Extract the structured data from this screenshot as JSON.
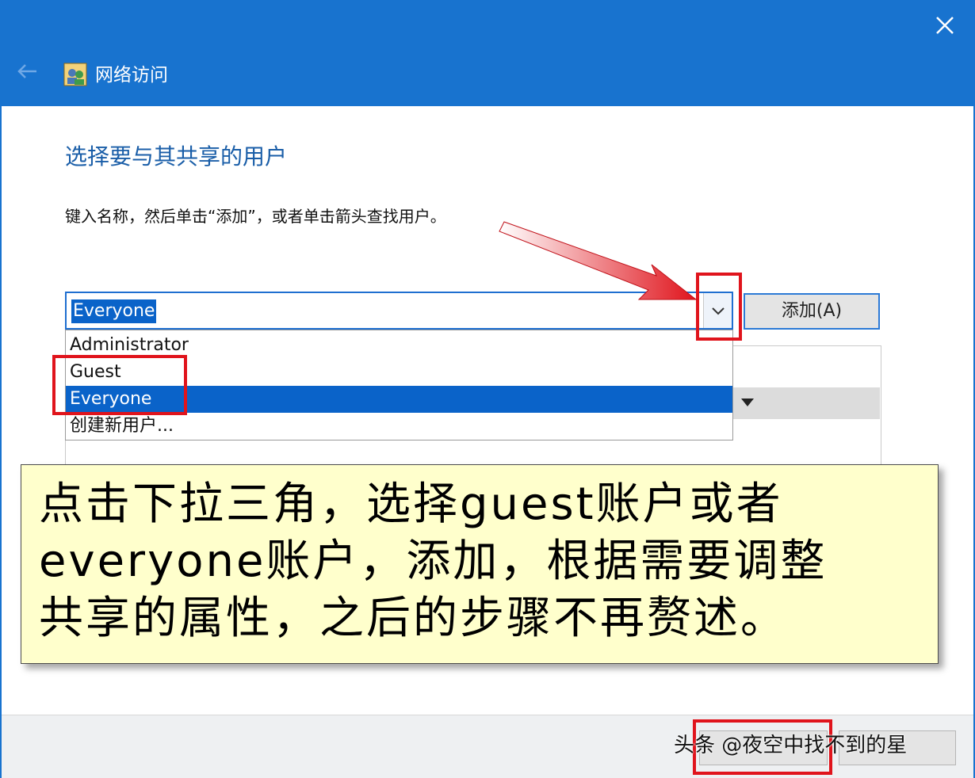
{
  "window": {
    "title": "网络访问"
  },
  "page": {
    "heading": "选择要与其共享的用户",
    "instruction": "键入名称，然后单击“添加”，或者单击箭头查找用户。"
  },
  "user_combo": {
    "value": "Everyone",
    "options": [
      "Administrator",
      "Guest",
      "Everyone",
      "创建新用户..."
    ],
    "selected": "Everyone"
  },
  "buttons": {
    "add": "添加(A)"
  },
  "annotation": {
    "line1": "点击下拉三角，选择guest账户或者",
    "line2": "everyone账户，添加，根据需要调整",
    "line3": "共享的属性，之后的步骤不再赘述。"
  },
  "watermark": "头条 @夜空中找不到的星",
  "colors": {
    "titlebar": "#1873cf",
    "highlight": "#e0141c",
    "selection": "#0a63c9",
    "note_bg": "#ffffcc"
  },
  "icons": {
    "back": "back-arrow-icon",
    "app": "network-users-icon",
    "close": "close-icon",
    "dropdown": "chevron-down-icon"
  }
}
